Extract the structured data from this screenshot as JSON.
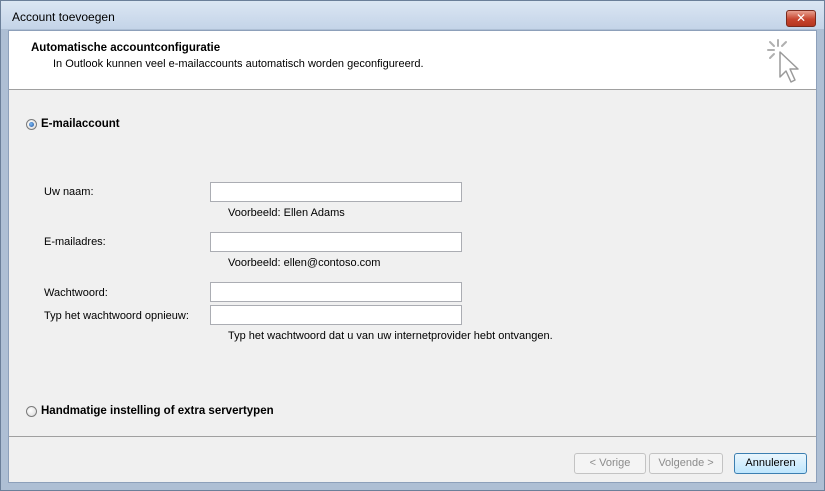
{
  "window": {
    "title": "Account toevoegen",
    "close_label": "✕"
  },
  "header": {
    "title": "Automatische accountconfiguratie",
    "subtitle": "In Outlook kunnen veel e-mailaccounts automatisch worden geconfigureerd."
  },
  "options": {
    "email_account": {
      "label": "E-mailaccount",
      "checked": true
    },
    "manual_setup": {
      "label": "Handmatige instelling of extra servertypen",
      "checked": false
    }
  },
  "form": {
    "name": {
      "label": "Uw naam:",
      "value": "",
      "hint": "Voorbeeld: Ellen Adams"
    },
    "email": {
      "label": "E-mailadres:",
      "value": "",
      "hint": "Voorbeeld: ellen@contoso.com"
    },
    "password": {
      "label": "Wachtwoord:",
      "value": ""
    },
    "password_confirm": {
      "label": "Typ het wachtwoord opnieuw:",
      "value": "",
      "hint": "Typ het wachtwoord dat u van uw internetprovider hebt ontvangen."
    }
  },
  "buttons": {
    "back": "< Vorige",
    "next": "Volgende >",
    "cancel": "Annuleren"
  },
  "colors": {
    "title_bar": "#c4d4e8",
    "dialog_background": "#f0f0f0",
    "close_button": "#c7452e"
  }
}
